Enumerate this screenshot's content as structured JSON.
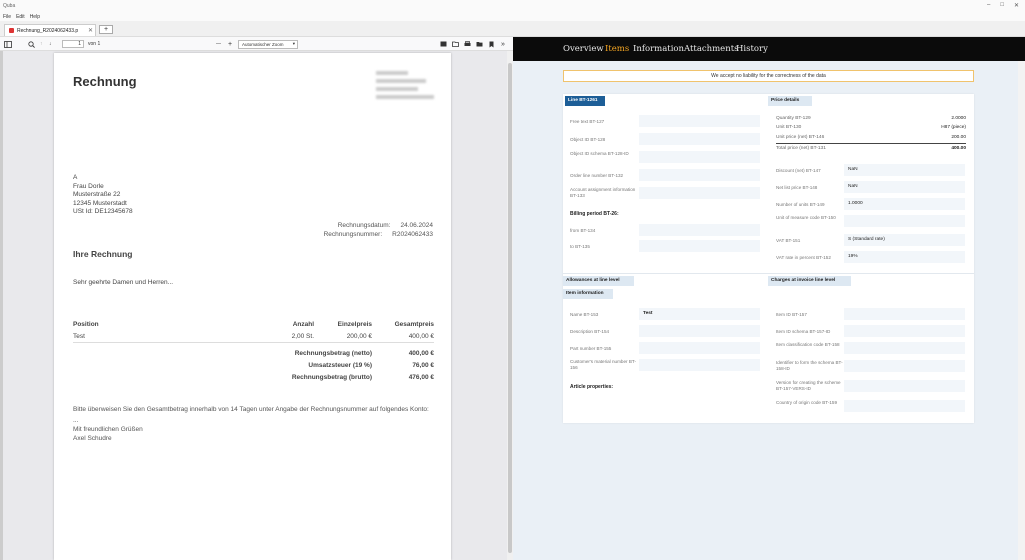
{
  "window": {
    "title": "Quba",
    "controls": [
      "–",
      "□",
      "✕"
    ]
  },
  "menu": [
    "File",
    "Edit",
    "Help"
  ],
  "tab": {
    "label": "Rechnung_R2024062433.p",
    "close": "✕",
    "new_tab": "+"
  },
  "pdf_toolbar": {
    "page_value": "1",
    "page_total": "von 1",
    "zoom_minus": "—",
    "zoom_plus": "+",
    "zoom_value": "Automatischer Zoom"
  },
  "invoice": {
    "title": "Rechnung",
    "address": [
      "A",
      "Frau Dorle",
      "Musterstraße 22",
      "12345 Musterstadt",
      "USt Id: DE12345678"
    ],
    "date_label": "Rechnungsdatum:",
    "date_value": "24.06.2024",
    "number_label": "Rechnungsnummer:",
    "number_value": "R2024062433",
    "subject": "Ihre Rechnung",
    "greeting": "Sehr geehrte Damen und Herren...",
    "table_head": {
      "position": "Position",
      "qty": "Anzahl",
      "unit_price": "Einzelpreis",
      "total": "Gesamtpreis"
    },
    "rows": [
      {
        "position": "Test",
        "qty": "2,00 St.",
        "unit_price": "200,00 €",
        "total": "400,00 €"
      }
    ],
    "totals": [
      {
        "label": "Rechnungsbetrag (netto)",
        "value": "400,00 €"
      },
      {
        "label": "Umsatzsteuer (19 %)",
        "value": "76,00 €"
      },
      {
        "label": "Rechnungsbetrag (brutto)",
        "value": "476,00 €"
      }
    ],
    "closing_1": "Bitte überweisen Sie den Gesamtbetrag innerhalb von 14 Tagen unter Angabe der Rechnungsnummer auf folgendes Konto:",
    "closing_2": "...",
    "closing_3": "Mit freundlichen Grüßen",
    "closing_4": "Axel Schudre"
  },
  "nav": {
    "items": [
      "Overview",
      "Items",
      "Information",
      "Attachments",
      "History"
    ],
    "active": "Items"
  },
  "notice": "We accept no liability for the correctness of the data",
  "line": {
    "header": "Line BT-1261",
    "fields": [
      {
        "label": "Free text BT-127",
        "value": ""
      },
      {
        "label": "Object ID BT-128",
        "value": ""
      },
      {
        "label": "Object ID schema BT-128-ID",
        "value": ""
      },
      {
        "label": "Order line number BT-132",
        "value": ""
      },
      {
        "label": "Account assignment information BT-133",
        "value": ""
      }
    ],
    "billing_title": "Billing period BT-26:",
    "billing": [
      {
        "label": "from BT-134",
        "value": ""
      },
      {
        "label": "to BT-135",
        "value": ""
      }
    ]
  },
  "price": {
    "header": "Price details",
    "rows": [
      {
        "label": "Quantity BT-129",
        "value": "2.0000"
      },
      {
        "label": "Unit BT-130",
        "value": "H87 (piece)"
      },
      {
        "label": "Unit price (net) BT-146",
        "value": "200.00"
      },
      {
        "label": "Total price (net) BT-131",
        "value": "400.00"
      }
    ],
    "fields": [
      {
        "label": "Discount (net) BT-147",
        "value": "NaN"
      },
      {
        "label": "Net list price BT-148",
        "value": "NaN"
      },
      {
        "label": "Number of units BT-149",
        "value": "1.0000"
      },
      {
        "label": "Unit of measure code BT-150",
        "value": ""
      },
      {
        "label": "VAT BT-151",
        "value": "S (Standard rate)"
      },
      {
        "label": "VAT rate in percent BT-152",
        "value": "19%"
      }
    ]
  },
  "allowances_header": "Allowances at line level",
  "charges_header": "Charges at invoice line level",
  "item_info": {
    "header": "Item information",
    "left": [
      {
        "label": "Name BT-153",
        "value": "Test"
      },
      {
        "label": "Description BT-154",
        "value": ""
      },
      {
        "label": "Part number BT-155",
        "value": ""
      },
      {
        "label": "Customer's material number BT-156",
        "value": ""
      }
    ],
    "article_title": "Article properties:",
    "right": [
      {
        "label": "Item ID BT-157",
        "value": ""
      },
      {
        "label": "Item ID schema BT-157-ID",
        "value": ""
      },
      {
        "label": "Item classification code BT-158",
        "value": ""
      },
      {
        "label": "Identifier to form the schema BT-158-ID",
        "value": ""
      },
      {
        "label": "Version for creating the scheme BT-157-VERS-ID",
        "value": ""
      },
      {
        "label": "Country of origin code BT-159",
        "value": ""
      }
    ]
  },
  "colors": {
    "accent": "#f5a623",
    "header_dark": "#1d5e97",
    "header_light": "#dde8f2"
  }
}
